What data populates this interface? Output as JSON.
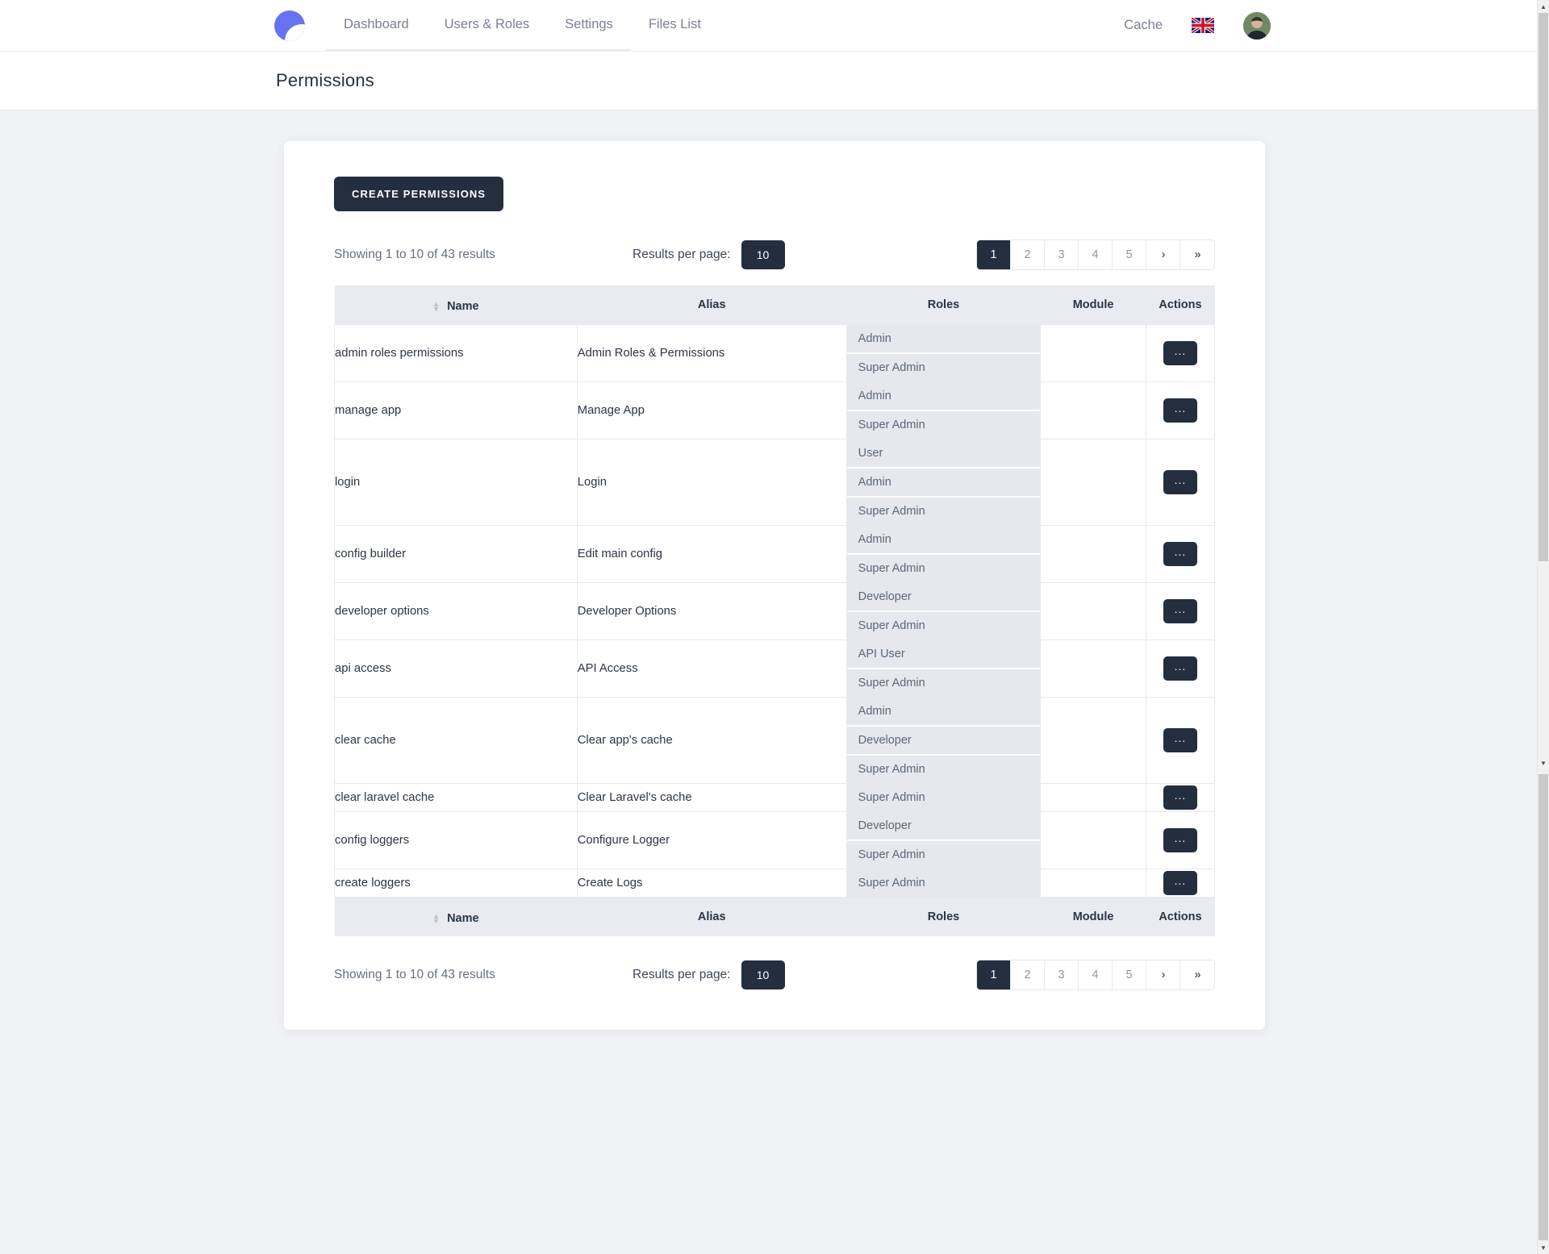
{
  "navbar": {
    "logo_name": "app-logo",
    "items": [
      {
        "label": "Dashboard"
      },
      {
        "label": "Users & Roles"
      },
      {
        "label": "Settings"
      },
      {
        "label": "Files List"
      }
    ],
    "cache_label": "Cache",
    "language_flag": "uk-flag-icon",
    "avatar": "user-avatar"
  },
  "page": {
    "title": "Permissions"
  },
  "toolbar": {
    "create_button": "CREATE PERMISSIONS",
    "showing_text": "Showing 1 to 10 of 43 results",
    "per_page_label": "Results per page:",
    "per_page_value": "10",
    "pages": [
      "1",
      "2",
      "3",
      "4",
      "5"
    ],
    "next_symbol": "›",
    "last_symbol": "»",
    "active_page": "1"
  },
  "table": {
    "columns": [
      "Name",
      "Alias",
      "Roles",
      "Module",
      "Actions"
    ],
    "action_label": "...",
    "rows": [
      {
        "name": "admin roles permissions",
        "alias": "Admin Roles & Permissions",
        "roles": [
          "Admin",
          "Super Admin"
        ],
        "module": ""
      },
      {
        "name": "manage app",
        "alias": "Manage App",
        "roles": [
          "Admin",
          "Super Admin"
        ],
        "module": ""
      },
      {
        "name": "login",
        "alias": "Login",
        "roles": [
          "User",
          "Admin",
          "Super Admin"
        ],
        "module": ""
      },
      {
        "name": "config builder",
        "alias": "Edit main config",
        "roles": [
          "Admin",
          "Super Admin"
        ],
        "module": ""
      },
      {
        "name": "developer options",
        "alias": "Developer Options",
        "roles": [
          "Developer",
          "Super Admin"
        ],
        "module": ""
      },
      {
        "name": "api access",
        "alias": "API Access",
        "roles": [
          "API User",
          "Super Admin"
        ],
        "module": ""
      },
      {
        "name": "clear cache",
        "alias": "Clear app's cache",
        "roles": [
          "Admin",
          "Developer",
          "Super Admin"
        ],
        "module": ""
      },
      {
        "name": "clear laravel cache",
        "alias": "Clear Laravel's cache",
        "roles": [
          "Super Admin"
        ],
        "module": ""
      },
      {
        "name": "config loggers",
        "alias": "Configure Logger",
        "roles": [
          "Developer",
          "Super Admin"
        ],
        "module": ""
      },
      {
        "name": "create loggers",
        "alias": "Create Logs",
        "roles": [
          "Super Admin"
        ],
        "module": ""
      }
    ]
  },
  "colors": {
    "accent": "#6772f0",
    "dark": "#232e3e",
    "page_bg": "#f1f2f5",
    "chip_bg": "#e6e8ee"
  }
}
